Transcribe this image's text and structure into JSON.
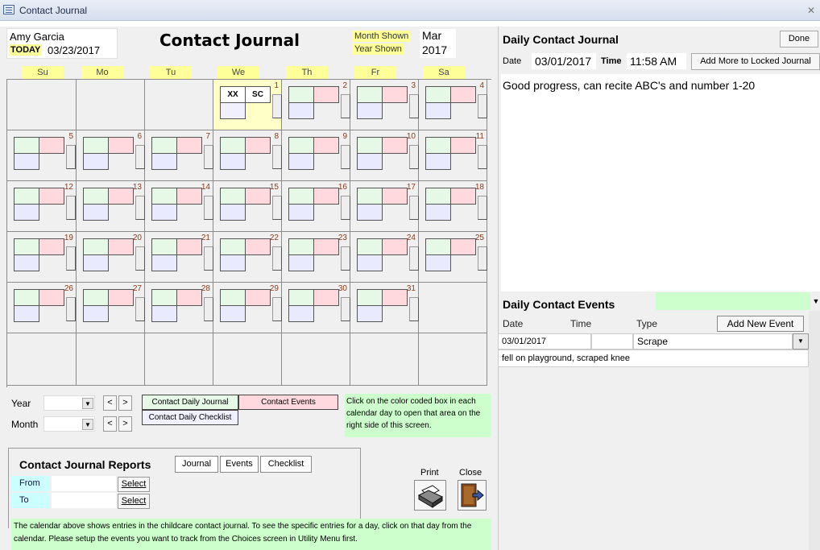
{
  "window": {
    "title": "Contact Journal",
    "close_glyph": "✕"
  },
  "header": {
    "user_name": "Amy Garcia",
    "today_label": "TODAY",
    "today_date": "03/23/2017",
    "app_title": "Contact Journal",
    "month_label": "Month Shown",
    "year_label": "Year Shown",
    "month_value": "Mar",
    "year_value": "2017"
  },
  "calendar": {
    "weekdays": [
      "Su",
      "Mo",
      "Tu",
      "We",
      "Th",
      "Fr",
      "Sa"
    ],
    "days": [
      {
        "n": "1",
        "marks": [
          "XX",
          "SC"
        ],
        "today": true
      },
      {
        "n": "2"
      },
      {
        "n": "3"
      },
      {
        "n": "4"
      },
      {
        "n": "5"
      },
      {
        "n": "6"
      },
      {
        "n": "7"
      },
      {
        "n": "8"
      },
      {
        "n": "9"
      },
      {
        "n": "10"
      },
      {
        "n": "11"
      },
      {
        "n": "12"
      },
      {
        "n": "13"
      },
      {
        "n": "14"
      },
      {
        "n": "15"
      },
      {
        "n": "16"
      },
      {
        "n": "17"
      },
      {
        "n": "18"
      },
      {
        "n": "19"
      },
      {
        "n": "20"
      },
      {
        "n": "21"
      },
      {
        "n": "22"
      },
      {
        "n": "23"
      },
      {
        "n": "24"
      },
      {
        "n": "25"
      },
      {
        "n": "26"
      },
      {
        "n": "27"
      },
      {
        "n": "28"
      },
      {
        "n": "29"
      },
      {
        "n": "30"
      },
      {
        "n": "31"
      }
    ]
  },
  "controls": {
    "year_label": "Year",
    "month_label": "Month",
    "prev": "<",
    "next": ">",
    "dropdown_glyph": "▼"
  },
  "legend": {
    "journal": "Contact Daily Journal",
    "events": "Contact Events",
    "checklist": "Contact Daily Checklist",
    "hint": "Click on the color coded box in each calendar day to open that area on the right side of this screen."
  },
  "reports": {
    "title": "Contact Journal Reports",
    "tabs": [
      "Journal",
      "Events",
      "Checklist"
    ],
    "from_label": "From",
    "to_label": "To",
    "select_label": "Select",
    "print_label": "Print",
    "close_label": "Close",
    "footer": "The calendar above shows entries in the childcare contact journal. To see the specific entries for a day, click on that day from the calendar.  Please setup the events you want to track from the Choices screen in Utility Menu first."
  },
  "journal": {
    "heading": "Daily Contact Journal",
    "done": "Done",
    "date_label": "Date",
    "date_value": "03/01/2017",
    "time_label": "Time",
    "time_value": "11:58 AM",
    "add_locked": "Add More to Locked Journal",
    "text": "Good progress, can recite ABC's and number 1-20"
  },
  "events": {
    "heading": "Daily Contact Events",
    "col_date": "Date",
    "col_time": "Time",
    "col_type": "Type",
    "add_new": "Add New Event",
    "row_date": "03/01/2017",
    "row_type": "Scrape",
    "row_desc": "fell on playground, scraped knee"
  },
  "colors": {
    "yellow": "#ffff99",
    "journal_green": "#e6f8e6",
    "events_pink": "#ffd9de",
    "checklist_lavender": "#eaeaff",
    "hint_green": "#ccffcc",
    "label_cyan": "#ccffff"
  }
}
